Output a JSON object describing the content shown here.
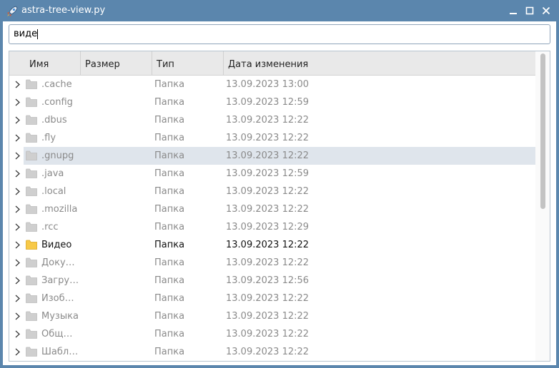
{
  "window": {
    "title": "astra-tree-view.py",
    "accent": "#5b86ad"
  },
  "search": {
    "value": "виде"
  },
  "columns": [
    "Имя",
    "Размер",
    "Тип",
    "Дата изменения"
  ],
  "rows": [
    {
      "name": ".cache",
      "type": "Папка",
      "date": "13.09.2023 13:00",
      "state": "dim"
    },
    {
      "name": ".config",
      "type": "Папка",
      "date": "13.09.2023 12:59",
      "state": "dim"
    },
    {
      "name": ".dbus",
      "type": "Папка",
      "date": "13.09.2023 12:22",
      "state": "dim"
    },
    {
      "name": ".fly",
      "type": "Папка",
      "date": "13.09.2023 12:22",
      "state": "dim"
    },
    {
      "name": ".gnupg",
      "type": "Папка",
      "date": "13.09.2023 12:22",
      "state": "selected"
    },
    {
      "name": ".java",
      "type": "Папка",
      "date": "13.09.2023 12:59",
      "state": "dim"
    },
    {
      "name": ".local",
      "type": "Папка",
      "date": "13.09.2023 12:22",
      "state": "dim"
    },
    {
      "name": ".mozilla",
      "type": "Папка",
      "date": "13.09.2023 12:22",
      "state": "dim"
    },
    {
      "name": ".rcc",
      "type": "Папка",
      "date": "13.09.2023 12:29",
      "state": "dim"
    },
    {
      "name": "Видео",
      "type": "Папка",
      "date": "13.09.2023 12:22",
      "state": "match"
    },
    {
      "name": "Доку…",
      "type": "Папка",
      "date": "13.09.2023 12:22",
      "state": "dim"
    },
    {
      "name": "Загру…",
      "type": "Папка",
      "date": "13.09.2023 12:56",
      "state": "dim"
    },
    {
      "name": "Изоб…",
      "type": "Папка",
      "date": "13.09.2023 12:22",
      "state": "dim"
    },
    {
      "name": "Музыка",
      "type": "Папка",
      "date": "13.09.2023 12:22",
      "state": "dim"
    },
    {
      "name": "Общ…",
      "type": "Папка",
      "date": "13.09.2023 12:22",
      "state": "dim"
    },
    {
      "name": "Шабл…",
      "type": "Папка",
      "date": "13.09.2023 12:22",
      "state": "dim"
    }
  ],
  "icons": {
    "app": "rocket-icon",
    "folder": "folder-icon",
    "expander": "chevron-right-icon"
  },
  "colors": {
    "folder_dim": "#cfcfcf",
    "folder_match": "#f7c948",
    "selection": "#dfe5ec"
  }
}
